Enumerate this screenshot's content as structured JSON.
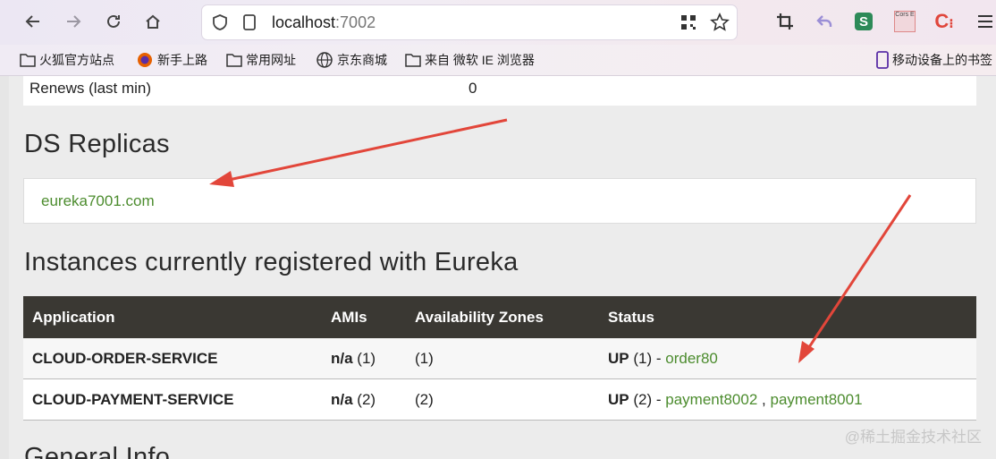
{
  "browser": {
    "url_host": "localhost",
    "url_port": ":7002",
    "bookmarks": [
      "火狐官方站点",
      "新手上路",
      "常用网址",
      "京东商城",
      "来自 微软 IE 浏览器"
    ],
    "mobile_bookmarks": "移动设备上的书签",
    "ext_cors_label": "Cors E"
  },
  "page": {
    "renews_label": "Renews (last min)",
    "renews_value": "0",
    "ds_replicas_title": "DS Replicas",
    "replica_link": "eureka7001.com",
    "instances_title": "Instances currently registered with Eureka",
    "general_info_title": "General Info",
    "table": {
      "headers": [
        "Application",
        "AMIs",
        "Availability Zones",
        "Status"
      ],
      "rows": [
        {
          "app": "CLOUD-ORDER-SERVICE",
          "ami_bold": "n/a",
          "ami_count": "(1)",
          "zones": "(1)",
          "status_bold": "UP",
          "status_count": "(1) -",
          "links": [
            "order80"
          ]
        },
        {
          "app": "CLOUD-PAYMENT-SERVICE",
          "ami_bold": "n/a",
          "ami_count": "(2)",
          "zones": "(2)",
          "status_bold": "UP",
          "status_count": "(2) -",
          "links": [
            "payment8002",
            "payment8001"
          ],
          "sep": ","
        }
      ]
    }
  },
  "watermark": "@稀土掘金技术社区",
  "colors": {
    "link_green": "#4c8c2e",
    "table_header": "#3a3833",
    "arrow_red": "#e2463a"
  }
}
